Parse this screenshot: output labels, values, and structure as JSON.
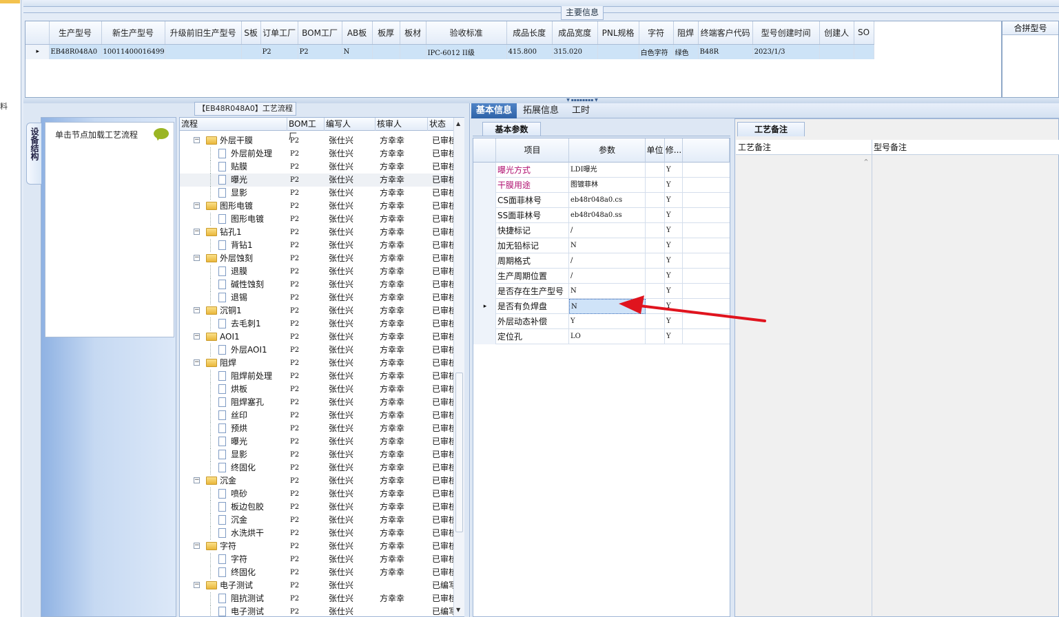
{
  "main_info": {
    "title": "主要信息"
  },
  "top_grid": {
    "columns": [
      "生产型号",
      "新生产型号",
      "升级前旧生产型号",
      "S板",
      "订单工厂",
      "BOM工厂",
      "AB板",
      "板厚",
      "板材",
      "验收标准",
      "成品长度",
      "成品宽度",
      "PNL规格",
      "字符",
      "阻焊",
      "终端客户代码",
      "型号创建时间",
      "创建人",
      "SO"
    ],
    "row": [
      "EB48R048A0",
      "10011400016499",
      "",
      "",
      "P2",
      "P2",
      "N",
      "",
      "",
      "IPC-6012 II级",
      "415.800",
      "315.020",
      "",
      "白色字符",
      "绿色",
      "B48R",
      "2023/1/3",
      "",
      ""
    ],
    "row_marker": "▸"
  },
  "merge_panel": {
    "title": "合拼型号"
  },
  "left_strip": {
    "glyph": "料"
  },
  "device_tab": {
    "label": "设备结构"
  },
  "load_box": {
    "text": "单击节点加载工艺流程"
  },
  "flow": {
    "title": "【EB48R048A0】工艺流程",
    "columns": [
      "流程",
      "BOM工厂",
      "编写人",
      "核审人",
      "状态"
    ],
    "rows": [
      {
        "name": "外层干膜",
        "level": 0,
        "bom": "P2",
        "writer": "张仕兴",
        "reviewer": "方幸幸",
        "status": "已审核"
      },
      {
        "name": "外层前处理",
        "level": 1,
        "bom": "P2",
        "writer": "张仕兴",
        "reviewer": "方幸幸",
        "status": "已审核"
      },
      {
        "name": "贴膜",
        "level": 1,
        "bom": "P2",
        "writer": "张仕兴",
        "reviewer": "方幸幸",
        "status": "已审核"
      },
      {
        "name": "曝光",
        "level": 1,
        "bom": "P2",
        "writer": "张仕兴",
        "reviewer": "方幸幸",
        "status": "已审核",
        "selected": true
      },
      {
        "name": "显影",
        "level": 1,
        "bom": "P2",
        "writer": "张仕兴",
        "reviewer": "方幸幸",
        "status": "已审核"
      },
      {
        "name": "图形电镀",
        "level": 0,
        "bom": "P2",
        "writer": "张仕兴",
        "reviewer": "方幸幸",
        "status": "已审核"
      },
      {
        "name": "图形电镀",
        "level": 1,
        "bom": "P2",
        "writer": "张仕兴",
        "reviewer": "方幸幸",
        "status": "已审核"
      },
      {
        "name": "钻孔1",
        "level": 0,
        "bom": "P2",
        "writer": "张仕兴",
        "reviewer": "方幸幸",
        "status": "已审核"
      },
      {
        "name": "背钻1",
        "level": 1,
        "bom": "P2",
        "writer": "张仕兴",
        "reviewer": "方幸幸",
        "status": "已审核"
      },
      {
        "name": "外层蚀刻",
        "level": 0,
        "bom": "P2",
        "writer": "张仕兴",
        "reviewer": "方幸幸",
        "status": "已审核"
      },
      {
        "name": "退膜",
        "level": 1,
        "bom": "P2",
        "writer": "张仕兴",
        "reviewer": "方幸幸",
        "status": "已审核"
      },
      {
        "name": "碱性蚀刻",
        "level": 1,
        "bom": "P2",
        "writer": "张仕兴",
        "reviewer": "方幸幸",
        "status": "已审核"
      },
      {
        "name": "退锡",
        "level": 1,
        "bom": "P2",
        "writer": "张仕兴",
        "reviewer": "方幸幸",
        "status": "已审核"
      },
      {
        "name": "沉铜1",
        "level": 0,
        "bom": "P2",
        "writer": "张仕兴",
        "reviewer": "方幸幸",
        "status": "已审核"
      },
      {
        "name": "去毛刺1",
        "level": 1,
        "bom": "P2",
        "writer": "张仕兴",
        "reviewer": "方幸幸",
        "status": "已审核"
      },
      {
        "name": "AOI1",
        "level": 0,
        "bom": "P2",
        "writer": "张仕兴",
        "reviewer": "方幸幸",
        "status": "已审核"
      },
      {
        "name": "外层AOI1",
        "level": 1,
        "bom": "P2",
        "writer": "张仕兴",
        "reviewer": "方幸幸",
        "status": "已审核"
      },
      {
        "name": "阻焊",
        "level": 0,
        "bom": "P2",
        "writer": "张仕兴",
        "reviewer": "方幸幸",
        "status": "已审核"
      },
      {
        "name": "阻焊前处理",
        "level": 1,
        "bom": "P2",
        "writer": "张仕兴",
        "reviewer": "方幸幸",
        "status": "已审核"
      },
      {
        "name": "烘板",
        "level": 1,
        "bom": "P2",
        "writer": "张仕兴",
        "reviewer": "方幸幸",
        "status": "已审核"
      },
      {
        "name": "阻焊塞孔",
        "level": 1,
        "bom": "P2",
        "writer": "张仕兴",
        "reviewer": "方幸幸",
        "status": "已审核"
      },
      {
        "name": "丝印",
        "level": 1,
        "bom": "P2",
        "writer": "张仕兴",
        "reviewer": "方幸幸",
        "status": "已审核"
      },
      {
        "name": "预烘",
        "level": 1,
        "bom": "P2",
        "writer": "张仕兴",
        "reviewer": "方幸幸",
        "status": "已审核"
      },
      {
        "name": "曝光",
        "level": 1,
        "bom": "P2",
        "writer": "张仕兴",
        "reviewer": "方幸幸",
        "status": "已审核"
      },
      {
        "name": "显影",
        "level": 1,
        "bom": "P2",
        "writer": "张仕兴",
        "reviewer": "方幸幸",
        "status": "已审核"
      },
      {
        "name": "终固化",
        "level": 1,
        "bom": "P2",
        "writer": "张仕兴",
        "reviewer": "方幸幸",
        "status": "已审核"
      },
      {
        "name": "沉金",
        "level": 0,
        "bom": "P2",
        "writer": "张仕兴",
        "reviewer": "方幸幸",
        "status": "已审核"
      },
      {
        "name": "喷砂",
        "level": 1,
        "bom": "P2",
        "writer": "张仕兴",
        "reviewer": "方幸幸",
        "status": "已审核"
      },
      {
        "name": "板边包胶",
        "level": 1,
        "bom": "P2",
        "writer": "张仕兴",
        "reviewer": "方幸幸",
        "status": "已审核"
      },
      {
        "name": "沉金",
        "level": 1,
        "bom": "P2",
        "writer": "张仕兴",
        "reviewer": "方幸幸",
        "status": "已审核"
      },
      {
        "name": "水洗烘干",
        "level": 1,
        "bom": "P2",
        "writer": "张仕兴",
        "reviewer": "方幸幸",
        "status": "已审核"
      },
      {
        "name": "字符",
        "level": 0,
        "bom": "P2",
        "writer": "张仕兴",
        "reviewer": "方幸幸",
        "status": "已审核"
      },
      {
        "name": "字符",
        "level": 1,
        "bom": "P2",
        "writer": "张仕兴",
        "reviewer": "方幸幸",
        "status": "已审核"
      },
      {
        "name": "终固化",
        "level": 1,
        "bom": "P2",
        "writer": "张仕兴",
        "reviewer": "方幸幸",
        "status": "已审核"
      },
      {
        "name": "电子测试",
        "level": 0,
        "bom": "P2",
        "writer": "张仕兴",
        "reviewer": "",
        "status": "已编写"
      },
      {
        "name": "阻抗测试",
        "level": 1,
        "bom": "P2",
        "writer": "张仕兴",
        "reviewer": "方幸幸",
        "status": "已审核"
      },
      {
        "name": "电子测试",
        "level": 1,
        "bom": "P2",
        "writer": "张仕兴",
        "reviewer": "",
        "status": "已编写"
      }
    ]
  },
  "tabs": {
    "items": [
      "基本信息",
      "拓展信息",
      "工时"
    ],
    "active": 0
  },
  "basic_params": {
    "tab_label": "基本参数",
    "columns": [
      "项目",
      "参数",
      "单位",
      "修..."
    ],
    "rows": [
      {
        "item": "曝光方式",
        "value": "LDI曝光",
        "unit": "",
        "mod": "Y",
        "highlight": true
      },
      {
        "item": "干膜用途",
        "value": "图镀菲林",
        "unit": "",
        "mod": "Y",
        "highlight": true
      },
      {
        "item": "CS面菲林号",
        "value": "eb48r048a0.cs",
        "unit": "",
        "mod": "Y"
      },
      {
        "item": "SS面菲林号",
        "value": "eb48r048a0.ss",
        "unit": "",
        "mod": "Y"
      },
      {
        "item": "快捷标记",
        "value": "/",
        "unit": "",
        "mod": "Y"
      },
      {
        "item": "加无铅标记",
        "value": "N",
        "unit": "",
        "mod": "Y"
      },
      {
        "item": "周期格式",
        "value": "/",
        "unit": "",
        "mod": "Y"
      },
      {
        "item": "生产周期位置",
        "value": "/",
        "unit": "",
        "mod": "Y"
      },
      {
        "item": "是否存在生产型号",
        "value": "N",
        "unit": "",
        "mod": "Y"
      },
      {
        "item": "是否有负焊盘",
        "value": "N",
        "unit": "",
        "mod": "Y",
        "selected": true
      },
      {
        "item": "外层动态补偿",
        "value": "Y",
        "unit": "",
        "mod": "Y"
      },
      {
        "item": "定位孔",
        "value": "LO",
        "unit": "",
        "mod": "Y"
      }
    ]
  },
  "notes": {
    "tab_label": "工艺备注",
    "col1": "工艺备注",
    "col2": "型号备注"
  },
  "colors": {
    "selected_row": "#cde3f7",
    "highlight_text": "#b01070",
    "active_tab": "#2f63a8",
    "annotation_arrow": "#e0141e"
  }
}
